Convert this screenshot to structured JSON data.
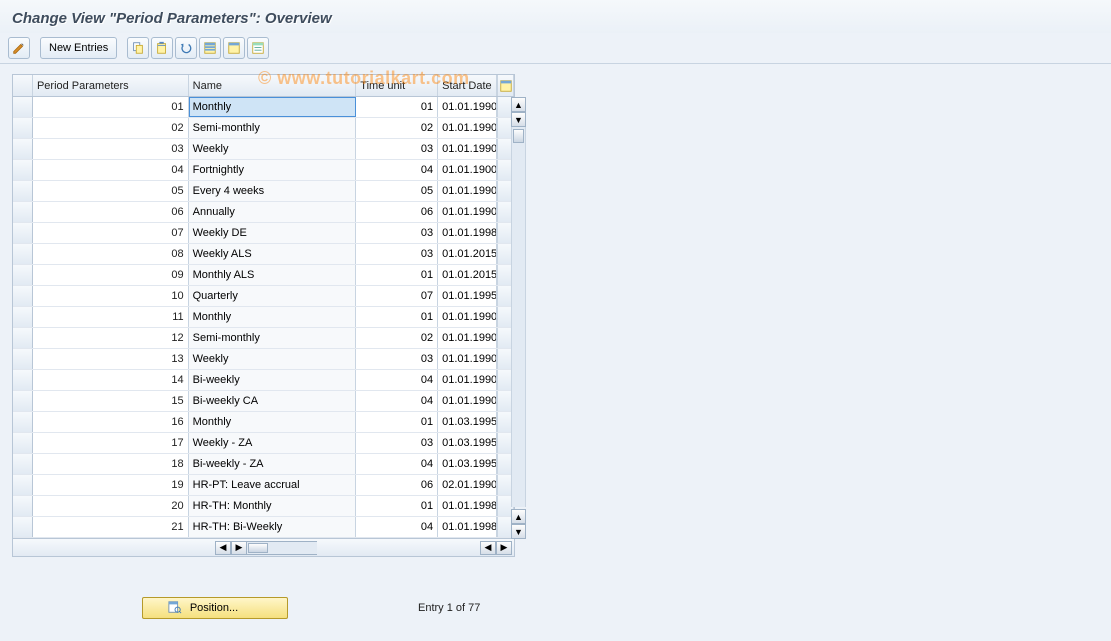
{
  "header": {
    "title": "Change View \"Period Parameters\": Overview"
  },
  "toolbar": {
    "new_entries_label": "New Entries"
  },
  "watermark": "© www.tutorialkart.com",
  "columns": {
    "period_parameters": "Period Parameters",
    "name": "Name",
    "time_unit": "Time unit",
    "start_date": "Start Date"
  },
  "rows": [
    {
      "pp": "01",
      "name": "Monthly",
      "tu": "01",
      "sd": "01.01.1990",
      "selected": true
    },
    {
      "pp": "02",
      "name": "Semi-monthly",
      "tu": "02",
      "sd": "01.01.1990"
    },
    {
      "pp": "03",
      "name": "Weekly",
      "tu": "03",
      "sd": "01.01.1990"
    },
    {
      "pp": "04",
      "name": "Fortnightly",
      "tu": "04",
      "sd": "01.01.1900"
    },
    {
      "pp": "05",
      "name": "Every 4 weeks",
      "tu": "05",
      "sd": "01.01.1990"
    },
    {
      "pp": "06",
      "name": "Annually",
      "tu": "06",
      "sd": "01.01.1990"
    },
    {
      "pp": "07",
      "name": "Weekly  DE",
      "tu": "03",
      "sd": "01.01.1998"
    },
    {
      "pp": "08",
      "name": "Weekly ALS",
      "tu": "03",
      "sd": "01.01.2015"
    },
    {
      "pp": "09",
      "name": "Monthly ALS",
      "tu": "01",
      "sd": "01.01.2015"
    },
    {
      "pp": "10",
      "name": "Quarterly",
      "tu": "07",
      "sd": "01.01.1995"
    },
    {
      "pp": "11",
      "name": "Monthly",
      "tu": "01",
      "sd": "01.01.1990"
    },
    {
      "pp": "12",
      "name": "Semi-monthly",
      "tu": "02",
      "sd": "01.01.1990"
    },
    {
      "pp": "13",
      "name": "Weekly",
      "tu": "03",
      "sd": "01.01.1990"
    },
    {
      "pp": "14",
      "name": "Bi-weekly",
      "tu": "04",
      "sd": "01.01.1990"
    },
    {
      "pp": "15",
      "name": "Bi-weekly CA",
      "tu": "04",
      "sd": "01.01.1990"
    },
    {
      "pp": "16",
      "name": "Monthly",
      "tu": "01",
      "sd": "01.03.1995"
    },
    {
      "pp": "17",
      "name": "Weekly - ZA",
      "tu": "03",
      "sd": "01.03.1995"
    },
    {
      "pp": "18",
      "name": "Bi-weekly - ZA",
      "tu": "04",
      "sd": "01.03.1995"
    },
    {
      "pp": "19",
      "name": "HR-PT: Leave accrual",
      "tu": "06",
      "sd": "02.01.1990"
    },
    {
      "pp": "20",
      "name": "HR-TH: Monthly",
      "tu": "01",
      "sd": "01.01.1998"
    },
    {
      "pp": "21",
      "name": "HR-TH: Bi-Weekly",
      "tu": "04",
      "sd": "01.01.1998"
    }
  ],
  "footer": {
    "position_label": "Position...",
    "entry_text": "Entry 1 of 77"
  }
}
